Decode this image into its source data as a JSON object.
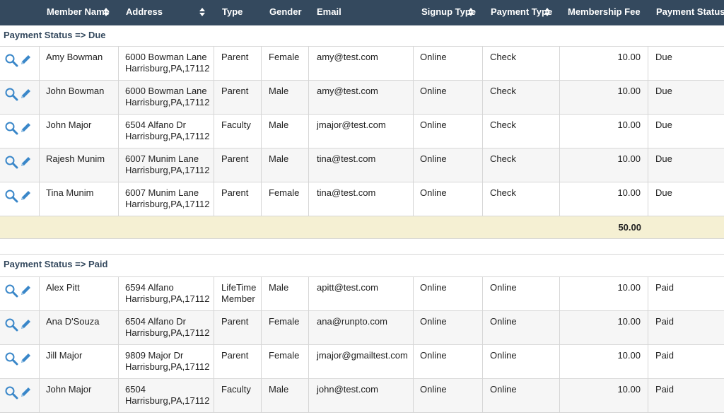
{
  "colors": {
    "header_bg": "#34495e",
    "header_text": "#ffffff",
    "group_label": "#34495e",
    "subtotal_bg": "#f5f0d3",
    "icon": "#3a87c9",
    "border": "#d6d6d6"
  },
  "header": {
    "member_name": "Member Name",
    "address": "Address",
    "type": "Type",
    "gender": "Gender",
    "email": "Email",
    "signup_type": "Signup Type",
    "payment_type": "Payment Type",
    "membership_fee": "Membership Fee",
    "payment_status": "Payment Status"
  },
  "groups": [
    {
      "label": "Payment Status => Due",
      "subtotal": "50.00",
      "rows": [
        {
          "name": "Amy Bowman",
          "address1": "6000 Bowman Lane",
          "address2": "Harrisburg,PA,17112",
          "type": "Parent",
          "type2": "",
          "gender": "Female",
          "email": "amy@test.com",
          "signup": "Online",
          "payment_type": "Check",
          "fee": "10.00",
          "status": "Due"
        },
        {
          "name": "John Bowman",
          "address1": "6000 Bowman Lane",
          "address2": "Harrisburg,PA,17112",
          "type": "Parent",
          "type2": "",
          "gender": "Male",
          "email": "amy@test.com",
          "signup": "Online",
          "payment_type": "Check",
          "fee": "10.00",
          "status": "Due"
        },
        {
          "name": "John Major",
          "address1": "6504 Alfano Dr",
          "address2": "Harrisburg,PA,17112",
          "type": "Faculty",
          "type2": "",
          "gender": "Male",
          "email": "jmajor@test.com",
          "signup": "Online",
          "payment_type": "Check",
          "fee": "10.00",
          "status": "Due"
        },
        {
          "name": "Rajesh Munim",
          "address1": "6007 Munim Lane",
          "address2": "Harrisburg,PA,17112",
          "type": "Parent",
          "type2": "",
          "gender": "Male",
          "email": "tina@test.com",
          "signup": "Online",
          "payment_type": "Check",
          "fee": "10.00",
          "status": "Due"
        },
        {
          "name": "Tina Munim",
          "address1": "6007 Munim Lane",
          "address2": "Harrisburg,PA,17112",
          "type": "Parent",
          "type2": "",
          "gender": "Female",
          "email": "tina@test.com",
          "signup": "Online",
          "payment_type": "Check",
          "fee": "10.00",
          "status": "Due"
        }
      ]
    },
    {
      "label": "Payment Status => Paid",
      "rows": [
        {
          "name": "Alex Pitt",
          "address1": "6594 Alfano",
          "address2": "Harrisburg,PA,17112",
          "type": "LifeTime",
          "type2": "Member",
          "gender": "Male",
          "email": "apitt@test.com",
          "signup": "Online",
          "payment_type": "Online",
          "fee": "10.00",
          "status": "Paid"
        },
        {
          "name": "Ana D'Souza",
          "address1": "6504 Alfano Dr",
          "address2": "Harrisburg,PA,17112",
          "type": "Parent",
          "type2": "",
          "gender": "Female",
          "email": "ana@runpto.com",
          "signup": "Online",
          "payment_type": "Online",
          "fee": "10.00",
          "status": "Paid"
        },
        {
          "name": "Jill Major",
          "address1": "9809 Major Dr",
          "address2": "Harrisburg,PA,17112",
          "type": "Parent",
          "type2": "",
          "gender": "Female",
          "email": "jmajor@gmailtest.com",
          "signup": "Online",
          "payment_type": "Online",
          "fee": "10.00",
          "status": "Paid"
        },
        {
          "name": "John Major",
          "address1": "6504",
          "address2": "Harrisburg,PA,17112",
          "type": "Faculty",
          "type2": "",
          "gender": "Male",
          "email": "john@test.com",
          "signup": "Online",
          "payment_type": "Online",
          "fee": "10.00",
          "status": "Paid"
        }
      ]
    }
  ],
  "icons": {
    "view": "search-icon",
    "edit": "pencil-icon",
    "sort": "sort-icon"
  }
}
